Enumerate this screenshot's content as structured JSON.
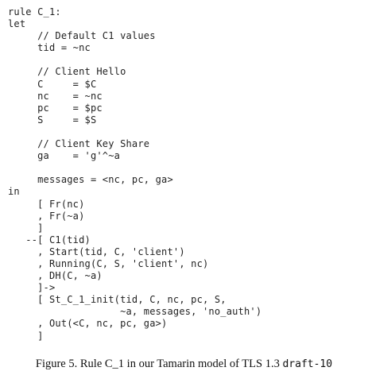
{
  "code": {
    "lines": [
      "rule C_1:",
      "let",
      "     // Default C1 values",
      "     tid = ~nc",
      "",
      "     // Client Hello",
      "     C     = $C",
      "     nc    = ~nc",
      "     pc    = $pc",
      "     S     = $S",
      "",
      "     // Client Key Share",
      "     ga    = 'g'^~a",
      "",
      "     messages = <nc, pc, ga>",
      "in",
      "     [ Fr(nc)",
      "     , Fr(~a)",
      "     ]",
      "   --[ C1(tid)",
      "     , Start(tid, C, 'client')",
      "     , Running(C, S, 'client', nc)",
      "     , DH(C, ~a)",
      "     ]->",
      "     [ St_C_1_init(tid, C, nc, pc, S,",
      "                   ~a, messages, 'no_auth')",
      "     , Out(<C, nc, pc, ga>)",
      "     ]"
    ]
  },
  "caption": {
    "text": "Figure 5. Rule C_1 in our Tamarin model of TLS 1.3 ",
    "code": "draft-10"
  }
}
